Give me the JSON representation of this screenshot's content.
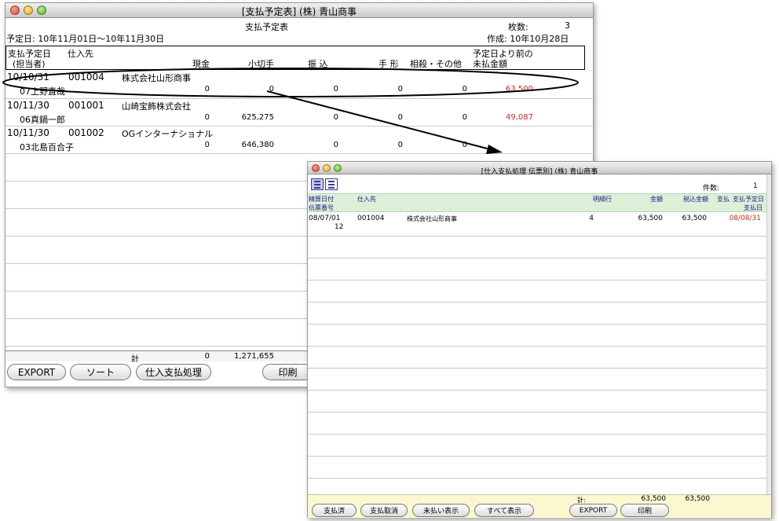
{
  "window1": {
    "title": "[支払予定表] (株) 青山商事",
    "report_title": "支払予定表",
    "page_count_label": "枚数:",
    "page_count": "3",
    "date_range": "予定日: 10年11月01日〜10年11月30日",
    "created": "作成: 10年10月28日",
    "headers": {
      "pay_date": "支払予定日",
      "staff": "(担当者)",
      "supplier": "仕入先",
      "cash": "現金",
      "check": "小切手",
      "transfer": "振 込",
      "bill": "手 形",
      "offset": "相殺・その他",
      "unpaid_1": "予定日より前の",
      "unpaid_2": "未払金額"
    },
    "rows": [
      {
        "date": "10/10/31",
        "code": "001004",
        "name": "株式会社山形商事",
        "staff": "07上野直哉",
        "cash": "0",
        "check": "0",
        "transfer": "0",
        "bill": "0",
        "offset": "0",
        "unpaid": "63,500"
      },
      {
        "date": "10/11/30",
        "code": "001001",
        "name": "山崎宝飾株式会社",
        "staff": "06真鍋一郎",
        "cash": "0",
        "check": "625,275",
        "transfer": "0",
        "bill": "0",
        "offset": "0",
        "unpaid": "49,087"
      },
      {
        "date": "10/11/30",
        "code": "001002",
        "name": "OGインターナショナル",
        "staff": "03北島百合子",
        "cash": "0",
        "check": "646,380",
        "transfer": "0",
        "bill": "0",
        "offset": "0",
        "unpaid": ""
      }
    ],
    "total_label": "計",
    "total_cash": "0",
    "total_check": "1,271,655",
    "buttons": {
      "export": "EXPORT",
      "sort": "ソート",
      "purchase_payment": "仕入支払処理",
      "print": "印刷"
    }
  },
  "window2": {
    "title": "[仕入支払処理 伝票別] (株) 青山商事",
    "count_label": "件数:",
    "count": "1",
    "headers": {
      "settle_date": "精算日付",
      "slip_no": "伝票番号",
      "supplier": "仕入先",
      "lines": "明細行",
      "amount": "金額",
      "tax_incl": "税込金額",
      "paid": "支払",
      "due_1": "支払予定日",
      "due_2": "支払日"
    },
    "rows": [
      {
        "date": "08/07/01",
        "slip": "12",
        "code": "001004",
        "name": "株式会社山形商事",
        "lines": "4",
        "amount": "63,500",
        "tax_incl": "63,500",
        "due": "08/08/31"
      }
    ],
    "total_label": "計:",
    "total_amount": "63,500",
    "total_tax": "63,500",
    "buttons": {
      "paid": "支払済",
      "cancel": "支払取消",
      "unpaid": "未払い表示",
      "all": "すべて表示",
      "export": "EXPORT",
      "print": "印刷"
    }
  },
  "colors": {
    "red": "#e0231f",
    "header_green": "#dcefd7",
    "footer_yellow": "#fbf8d0"
  }
}
